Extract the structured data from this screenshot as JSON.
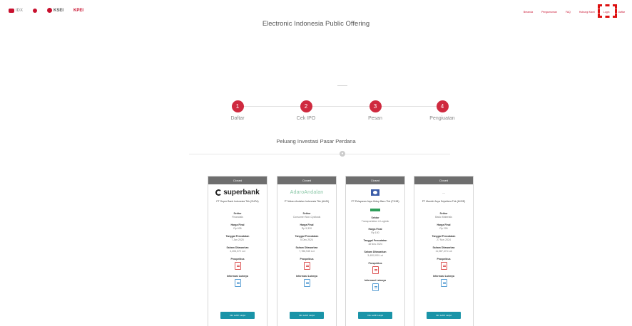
{
  "header": {
    "logos": [
      {
        "name": "idx-logo",
        "text": "IDX"
      },
      {
        "name": "pin-logo",
        "text": ""
      },
      {
        "name": "ksei-logo",
        "text": "KSEI"
      },
      {
        "name": "kpei-logo",
        "text": "KPEI"
      }
    ],
    "nav": [
      "Beranda",
      "Pengumuman",
      "FAQ",
      "Hubungi Kami",
      "Login",
      "Daftar"
    ],
    "title": "Electronic Indonesia Public Offering"
  },
  "steps": [
    {
      "num": "1",
      "label": "Daftar"
    },
    {
      "num": "2",
      "label": "Cek IPO"
    },
    {
      "num": "3",
      "label": "Pesan"
    },
    {
      "num": "4",
      "label": "Pengiuatan"
    }
  ],
  "section": {
    "title": "Peluang Investasi Pasar Perdana"
  },
  "cards": [
    {
      "status": "Closed",
      "logo": "superbank",
      "company": "PT Super Bank Indonesia Tbk (SUPA)",
      "sector_label": "Sektor",
      "sector": "Financials",
      "price_label": "Harga Final",
      "price": "Rp 635",
      "date_label": "Tanggal Pencatatan",
      "date": "7 Jan 2025",
      "shares_label": "Saham Ditawarkan",
      "shares": "4,406,072 Lot",
      "prospectus_label": "Prospektus",
      "info_label": "Informasi Lainnya",
      "button": "Info Lebih Lanjut"
    },
    {
      "status": "Closed",
      "logo": "AdaroAndalan",
      "company": "PT Adaro Andalan Indonesia Tbk (AADI)",
      "sector_label": "Sektor",
      "sector": "Consumer Non-Cyclicals",
      "price_label": "Harga Final",
      "price": "Rp 5,320",
      "date_label": "Tanggal Pencatatan",
      "date": "5 Dec 2024",
      "shares_label": "Saham Ditawarkan",
      "shares": "7,786,945 Lot",
      "prospectus_label": "Prospektus",
      "info_label": "Informasi Lainnya",
      "button": "Info Lebih Lanjut"
    },
    {
      "status": "Closed",
      "logo": "flag",
      "company": "PT Pelayaran Jaya Hidup Baru Tbk (PJHB)",
      "sector_label": "Sektor",
      "sector": "Transportation & Logistic",
      "price_label": "Harga Final",
      "price": "Rp 100",
      "date_label": "Tanggal Pencatatan",
      "date": "18 Nov 2024",
      "shares_label": "Saham Ditawarkan",
      "shares": "3,400,000 Lot",
      "prospectus_label": "Prospektus",
      "info_label": "Informasi Lainnya",
      "button": "Info Lebih Lanjut"
    },
    {
      "status": "Closed",
      "logo": "small",
      "company": "PT Mandiri Jaya Sejahtera Tbk (MJSE)",
      "sector_label": "Sektor",
      "sector": "Basic Materials",
      "price_label": "Harga Final",
      "price": "Rp 226",
      "date_label": "Tanggal Pencatatan",
      "date": "27 Nov 2024",
      "shares_label": "Saham Ditawarkan",
      "shares": "11,087,474 Lot",
      "prospectus_label": "Prospektus",
      "info_label": "Informasi Lainnya",
      "button": "Info Lebih Lanjut"
    }
  ]
}
